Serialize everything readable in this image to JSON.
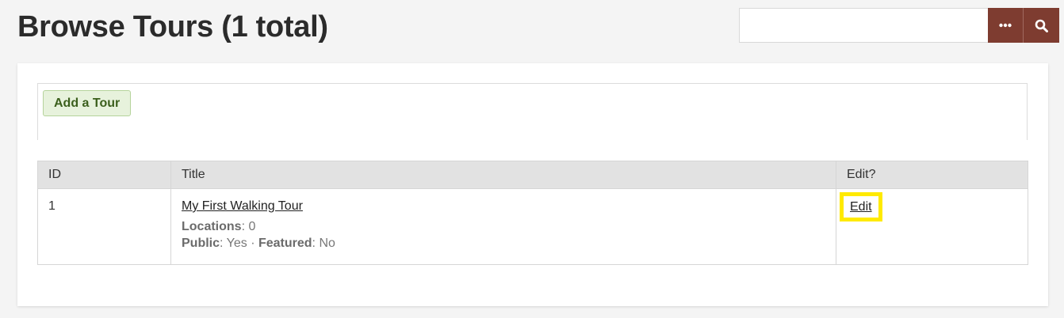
{
  "header": {
    "title": "Browse Tours (1 total)"
  },
  "search": {
    "value": "",
    "placeholder": "",
    "options_icon": "ellipsis-icon",
    "submit_icon": "search-icon"
  },
  "actions": {
    "add_tour_label": "Add a Tour"
  },
  "table": {
    "columns": [
      "ID",
      "Title",
      "Edit?"
    ],
    "rows": [
      {
        "id": "1",
        "title": "My First Walking Tour",
        "locations_label": "Locations",
        "locations_value": "0",
        "public_label": "Public",
        "public_value": "Yes",
        "separator": "·",
        "featured_label": "Featured",
        "featured_value": "No",
        "edit_label": "Edit"
      }
    ]
  },
  "colors": {
    "accent": "#7e3c30",
    "add_button_bg": "#e7f2dc",
    "add_button_text": "#3b5f1c",
    "highlight": "#ffea00"
  }
}
